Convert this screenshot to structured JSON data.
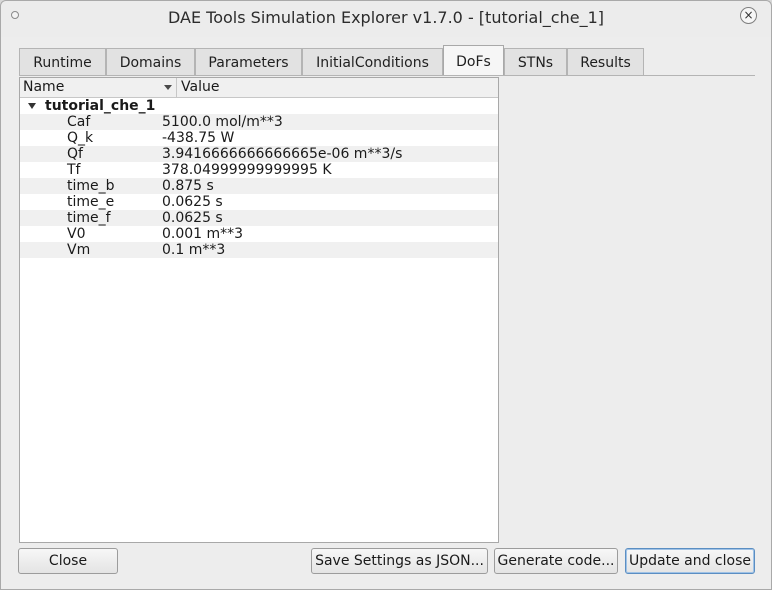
{
  "window": {
    "title": "DAE Tools Simulation Explorer v1.7.0 - [tutorial_che_1]",
    "close_glyph": "×"
  },
  "tabs": [
    {
      "label": "Runtime"
    },
    {
      "label": "Domains"
    },
    {
      "label": "Parameters"
    },
    {
      "label": "InitialConditions"
    },
    {
      "label": "DoFs",
      "active": true
    },
    {
      "label": "STNs"
    },
    {
      "label": "Results"
    }
  ],
  "tree": {
    "columns": {
      "name": "Name",
      "value": "Value"
    },
    "root": "tutorial_che_1",
    "rows": [
      {
        "name": "Caf",
        "value": "5100.0 mol/m**3"
      },
      {
        "name": "Q_k",
        "value": "-438.75 W"
      },
      {
        "name": "Qf",
        "value": "3.9416666666666665e-06 m**3/s"
      },
      {
        "name": "Tf",
        "value": "378.04999999999995 K"
      },
      {
        "name": "time_b",
        "value": "0.875 s"
      },
      {
        "name": "time_e",
        "value": "0.0625 s"
      },
      {
        "name": "time_f",
        "value": "0.0625 s"
      },
      {
        "name": "V0",
        "value": "0.001 m**3"
      },
      {
        "name": "Vm",
        "value": "0.1 m**3"
      }
    ]
  },
  "buttons": {
    "close": "Close",
    "save_settings": "Save Settings as JSON...",
    "generate_code": "Generate code...",
    "update_close": "Update and close"
  },
  "colors": {
    "default_button_border": "#5b8ec2",
    "alt_row": "#f0f0f0"
  }
}
